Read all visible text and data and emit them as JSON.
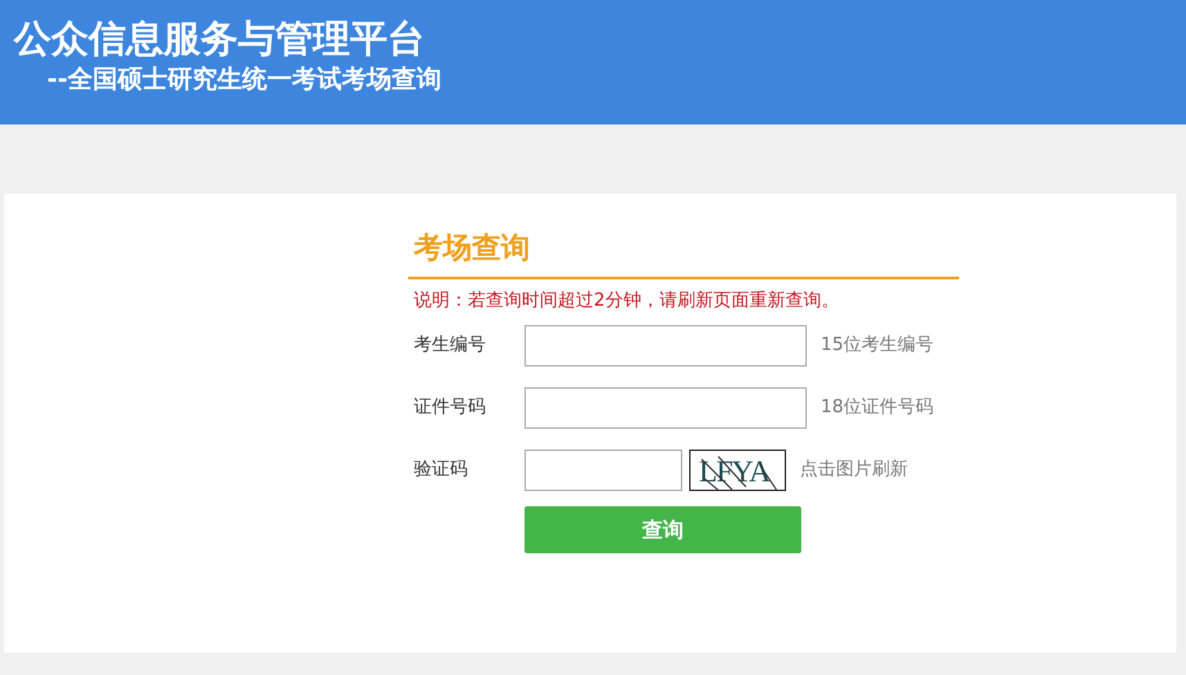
{
  "header": {
    "title": "公众信息服务与管理平台",
    "subtitle": "--全国硕士研究生统一考试考场查询"
  },
  "form": {
    "title": "考场查询",
    "note": "说明：若查询时间超过2分钟，请刷新页面重新查询。",
    "fields": [
      {
        "kind": "text",
        "label": "考生编号",
        "hint": "15位考生编号"
      },
      {
        "kind": "text",
        "label": "证件号码",
        "hint": "18位证件号码"
      },
      {
        "kind": "captcha",
        "label": "验证码",
        "captcha_text": "LFYA",
        "hint": "点击图片刷新"
      }
    ],
    "submit": "查询"
  }
}
